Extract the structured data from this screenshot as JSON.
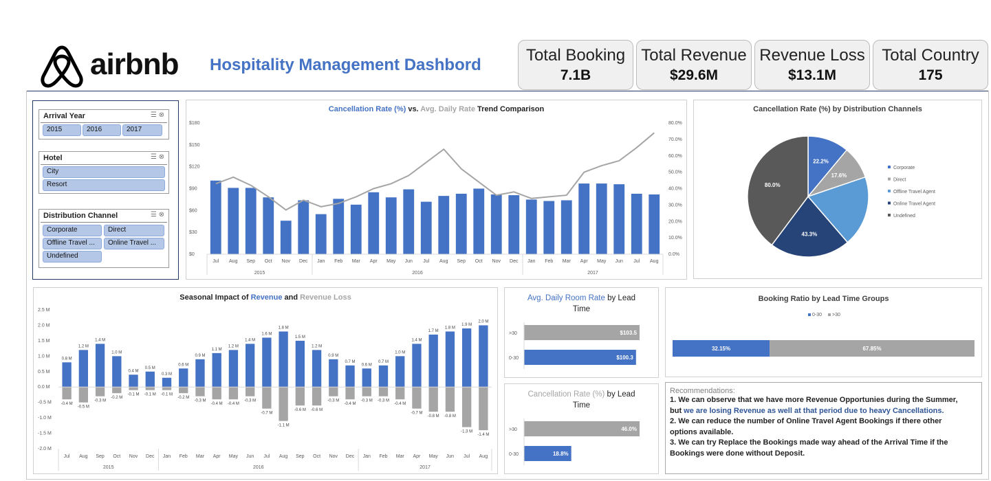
{
  "brand": {
    "name": "airbnb",
    "title": "Hospitality Management Dashbord"
  },
  "kpis": [
    {
      "label": "Total Booking",
      "value": "7.1B"
    },
    {
      "label": "Total Revenue",
      "value": "$29.6M"
    },
    {
      "label": "Revenue Loss",
      "value": "$13.1M"
    },
    {
      "label": "Total Country",
      "value": "175"
    }
  ],
  "slicers": {
    "arrival_year": {
      "title": "Arrival Year",
      "items": [
        "2015",
        "2016",
        "2017"
      ]
    },
    "hotel": {
      "title": "Hotel",
      "items": [
        "City",
        "Resort"
      ]
    },
    "channel": {
      "title": "Distribution Channel",
      "items": [
        "Corporate",
        "Direct",
        "Offline Travel ...",
        "Online Travel ...",
        "Undefined"
      ]
    }
  },
  "colors": {
    "blue": "#4472c4",
    "gray": "#a5a5a5",
    "title_blue": "#4472c4",
    "dark_gray": "#595959",
    "light_blue": "#5b9bd5",
    "navy": "#264478"
  },
  "trend": {
    "title_a": "Cancellation Rate (%)",
    "title_vs": " vs. ",
    "title_b": "Avg. Daily Rate",
    "title_c": " Trend Comparison",
    "months": [
      "Jul",
      "Aug",
      "Sep",
      "Oct",
      "Nov",
      "Dec",
      "Jan",
      "Feb",
      "Mar",
      "Apr",
      "May",
      "Jun",
      "Jul",
      "Aug",
      "Sep",
      "Oct",
      "Nov",
      "Dec",
      "Jan",
      "Feb",
      "Mar",
      "Apr",
      "May",
      "Jun",
      "Jul",
      "Aug"
    ],
    "years": [
      "2015",
      "2016",
      "2017"
    ],
    "left_ticks": [
      "$180",
      "$150",
      "$120",
      "$90",
      "$60",
      "$30",
      "$0"
    ],
    "right_ticks": [
      "80.0%",
      "70.0%",
      "60.0%",
      "50.0%",
      "40.0%",
      "30.0%",
      "20.0%",
      "10.0%",
      "0.0%"
    ]
  },
  "seasonal": {
    "title_a": "Seasonal Impact of ",
    "title_b": "Revenue",
    "title_c": " and ",
    "title_d": "Revenue Loss",
    "y_ticks": [
      "2.5 M",
      "2.0 M",
      "1.5 M",
      "1.0 M",
      "0.5 M",
      "0.0 M",
      "-0.5 M",
      "-1.0 M",
      "-1.5 M",
      "-2.0 M"
    ],
    "rev_labels": [
      "0.8 M",
      "1.2 M",
      "1.4 M",
      "1.0 M",
      "0.4 M",
      "0.5 M",
      "0.3 M",
      "0.6 M",
      "0.9 M",
      "1.1 M",
      "1.2 M",
      "1.4 M",
      "1.6 M",
      "1.8 M",
      "1.5 M",
      "1.2 M",
      "0.9 M",
      "0.7 M",
      "0.6 M",
      "0.7 M",
      "1.0 M",
      "1.4 M",
      "1.7 M",
      "1.8 M",
      "1.9 M",
      "2.0 M"
    ],
    "loss_labels": [
      "-0.4 M",
      "-0.5 M",
      "-0.3 M",
      "-0.2 M",
      "-0.1 M",
      "-0.1 M",
      "-0.1 M",
      "-0.2 M",
      "-0.3 M",
      "-0.4 M",
      "-0.4 M",
      "-0.3 M",
      "-0.7 M",
      "-1.1 M",
      "-0.6 M",
      "-0.6 M",
      "-0.3 M",
      "-0.4 M",
      "-0.3 M",
      "-0.3 M",
      "-0.4 M",
      "-0.7 M",
      "-0.8 M",
      "-0.8 M",
      "-1.3 M",
      "-1.4 M"
    ]
  },
  "pie": {
    "title": "Cancellation Rate (%) by Distribution Channels",
    "legend": [
      "Corporate",
      "Direct",
      "Offline Travel Agent",
      "Online Travel Agent",
      "Undefined"
    ],
    "labels": [
      "22.2%",
      "17.6%",
      "",
      "43.3%",
      "80.0%"
    ]
  },
  "adr_lead": {
    "title_a": "Avg. Daily Room Rate",
    "title_b": " by Lead",
    "title_c": "Time",
    "cats": [
      ">30",
      "0-30"
    ],
    "labels": [
      "$103.5",
      "$100.3"
    ]
  },
  "cxl_lead": {
    "title_a": "Cancellation Rate (%)",
    "title_b": " by Lead",
    "title_c": "Time",
    "cats": [
      ">30",
      "0-30"
    ],
    "labels": [
      "46.0%",
      "18.8%"
    ]
  },
  "booking_ratio": {
    "title": "Booking Ratio by Lead Time Groups",
    "legend": [
      "0-30",
      ">30"
    ],
    "labels": [
      "32.15%",
      "67.85%"
    ]
  },
  "recommendations": {
    "heading": "Recommendations:",
    "l1": "1. We can observe that we have more Revenue Opportunies during the Summer,",
    "l2a": "but ",
    "l2b": "we are losing Revenue as well at that period due to heavy Cancellations.",
    "l3": "2. We can reduce the number of Online Travel Agent Bookings if there other",
    "l4": "options available.",
    "l5": "3. We can try Replace the Bookings made way ahead of the Arrival Time if the",
    "l6": "Bookings were done without Deposit."
  },
  "chart_data": [
    {
      "type": "bar",
      "title": "Cancellation Rate (%) vs. Avg. Daily Rate Trend Comparison",
      "categories": [
        "Jul 2015",
        "Aug 2015",
        "Sep 2015",
        "Oct 2015",
        "Nov 2015",
        "Dec 2015",
        "Jan 2016",
        "Feb 2016",
        "Mar 2016",
        "Apr 2016",
        "May 2016",
        "Jun 2016",
        "Jul 2016",
        "Aug 2016",
        "Sep 2016",
        "Oct 2016",
        "Nov 2016",
        "Dec 2016",
        "Jan 2017",
        "Feb 2017",
        "Mar 2017",
        "Apr 2017",
        "May 2017",
        "Jun 2017",
        "Jul 2017",
        "Aug 2017"
      ],
      "series": [
        {
          "name": "Cancellation Rate (%)",
          "axis": "left",
          "values": [
            101,
            91,
            91,
            78,
            46,
            74,
            55,
            76,
            68,
            85,
            78,
            89,
            72,
            80,
            83,
            90,
            82,
            81,
            75,
            73,
            74,
            97,
            97,
            96,
            83,
            82
          ]
        },
        {
          "name": "Avg. Daily Rate",
          "type": "line",
          "axis": "right",
          "values": [
            43,
            47,
            42,
            35,
            27,
            33,
            29,
            31,
            35,
            40,
            43,
            48,
            56,
            64,
            52,
            44,
            36,
            38,
            34,
            35,
            36,
            50,
            54,
            57,
            65,
            74
          ]
        }
      ],
      "ylim": [
        0,
        180
      ],
      "y2lim": [
        0,
        80
      ],
      "grid": false
    },
    {
      "type": "bar",
      "title": "Seasonal Impact of Revenue and Revenue Loss",
      "categories": [
        "Jul 2015",
        "Aug 2015",
        "Sep 2015",
        "Oct 2015",
        "Nov 2015",
        "Dec 2015",
        "Jan 2016",
        "Feb 2016",
        "Mar 2016",
        "Apr 2016",
        "May 2016",
        "Jun 2016",
        "Jul 2016",
        "Aug 2016",
        "Sep 2016",
        "Oct 2016",
        "Nov 2016",
        "Dec 2016",
        "Jan 2017",
        "Feb 2017",
        "Mar 2017",
        "Apr 2017",
        "May 2017",
        "Jun 2017",
        "Jul 2017",
        "Aug 2017"
      ],
      "series": [
        {
          "name": "Revenue",
          "values": [
            0.8,
            1.2,
            1.4,
            1.0,
            0.4,
            0.5,
            0.3,
            0.6,
            0.9,
            1.1,
            1.2,
            1.4,
            1.6,
            1.8,
            1.5,
            1.2,
            0.9,
            0.7,
            0.6,
            0.7,
            1.0,
            1.4,
            1.7,
            1.8,
            1.9,
            2.0
          ]
        },
        {
          "name": "Revenue Loss",
          "values": [
            -0.4,
            -0.5,
            -0.3,
            -0.2,
            -0.1,
            -0.1,
            -0.1,
            -0.2,
            -0.3,
            -0.4,
            -0.4,
            -0.3,
            -0.7,
            -1.1,
            -0.6,
            -0.6,
            -0.3,
            -0.4,
            -0.3,
            -0.3,
            -0.4,
            -0.7,
            -0.8,
            -0.8,
            -1.3,
            -1.4
          ]
        }
      ],
      "ylim": [
        -2.0,
        2.5
      ],
      "grid": false
    },
    {
      "type": "pie",
      "title": "Cancellation Rate (%) by Distribution Channels",
      "categories": [
        "Corporate",
        "Direct",
        "Offline Travel Agent",
        "Online Travel Agent",
        "Undefined"
      ],
      "values": [
        22.2,
        17.6,
        38.0,
        43.3,
        80.0
      ],
      "legend": "right"
    },
    {
      "type": "bar",
      "title": "Avg. Daily Room Rate by Lead Time",
      "categories": [
        ">30",
        "0-30"
      ],
      "values": [
        103.5,
        100.3
      ],
      "orientation": "horizontal"
    },
    {
      "type": "bar",
      "title": "Cancellation Rate (%) by Lead Time",
      "categories": [
        ">30",
        "0-30"
      ],
      "values": [
        46.0,
        18.8
      ],
      "orientation": "horizontal"
    },
    {
      "type": "bar",
      "title": "Booking Ratio by Lead Time Groups",
      "categories": [
        "0-30",
        ">30"
      ],
      "values": [
        32.15,
        67.85
      ],
      "orientation": "horizontal",
      "stacked": true,
      "legend": "top"
    }
  ]
}
